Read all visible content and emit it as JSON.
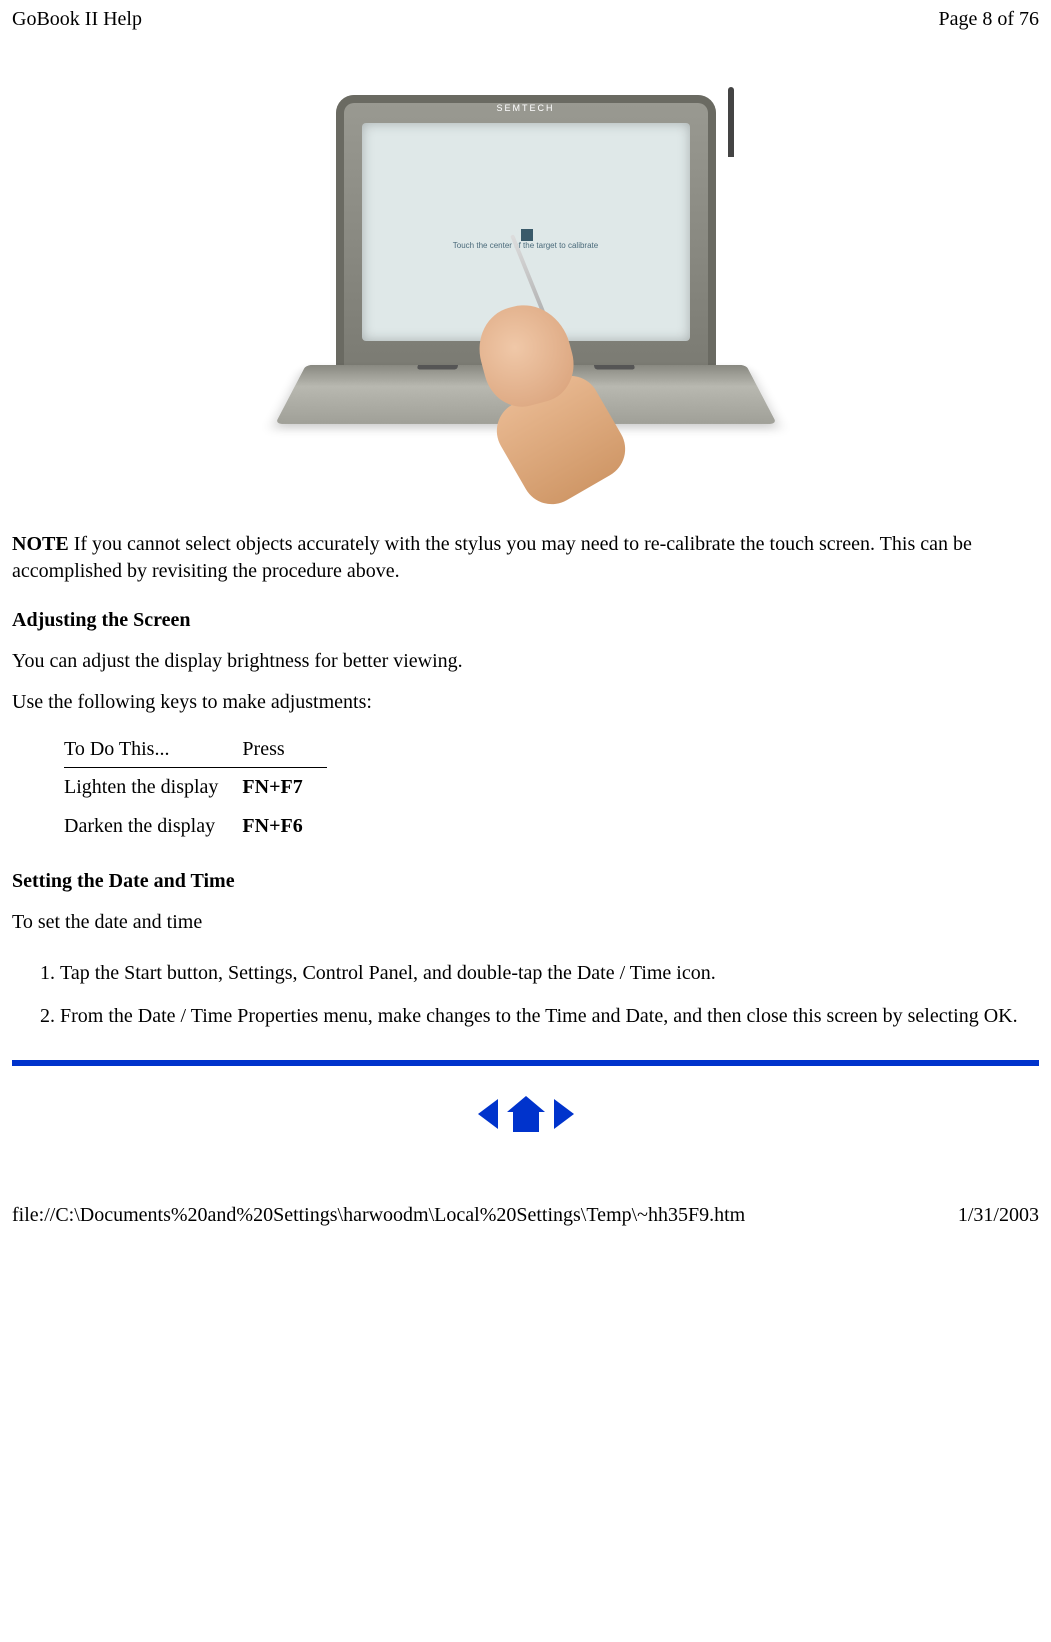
{
  "header": {
    "title": "GoBook II Help",
    "page_indicator": "Page 8 of 76"
  },
  "image": {
    "brand": "SEMTECH",
    "screen_text": "Touch the center of the target to calibrate"
  },
  "note": {
    "label": "NOTE",
    "text": "  If you cannot select objects accurately with the stylus you may need to re-calibrate the touch screen.  This can be accomplished by revisiting the procedure above."
  },
  "sections": {
    "adjusting": {
      "heading": "Adjusting the Screen",
      "intro": "You can adjust the display brightness for better viewing.",
      "instruction": "Use the following keys to make adjustments:",
      "table": {
        "col1_header": "To Do This...",
        "col2_header": "Press",
        "rows": [
          {
            "action": "Lighten  the display",
            "key": "FN+F7"
          },
          {
            "action": "Darken the display",
            "key": "FN+F6"
          }
        ]
      }
    },
    "datetime": {
      "heading": "Setting the Date and Time",
      "intro": "To set the date and time",
      "steps": [
        "Tap the Start button,  Settings, Control Panel, and double-tap the Date / Time icon.",
        "From the Date / Time Properties menu,  make changes to the Time and Date, and then close this screen by selecting OK."
      ]
    }
  },
  "nav": {
    "prev": "Previous",
    "home": "Home",
    "next": "Next"
  },
  "footer": {
    "path": "file://C:\\Documents%20and%20Settings\\harwoodm\\Local%20Settings\\Temp\\~hh35F9.htm",
    "date": "1/31/2003"
  }
}
